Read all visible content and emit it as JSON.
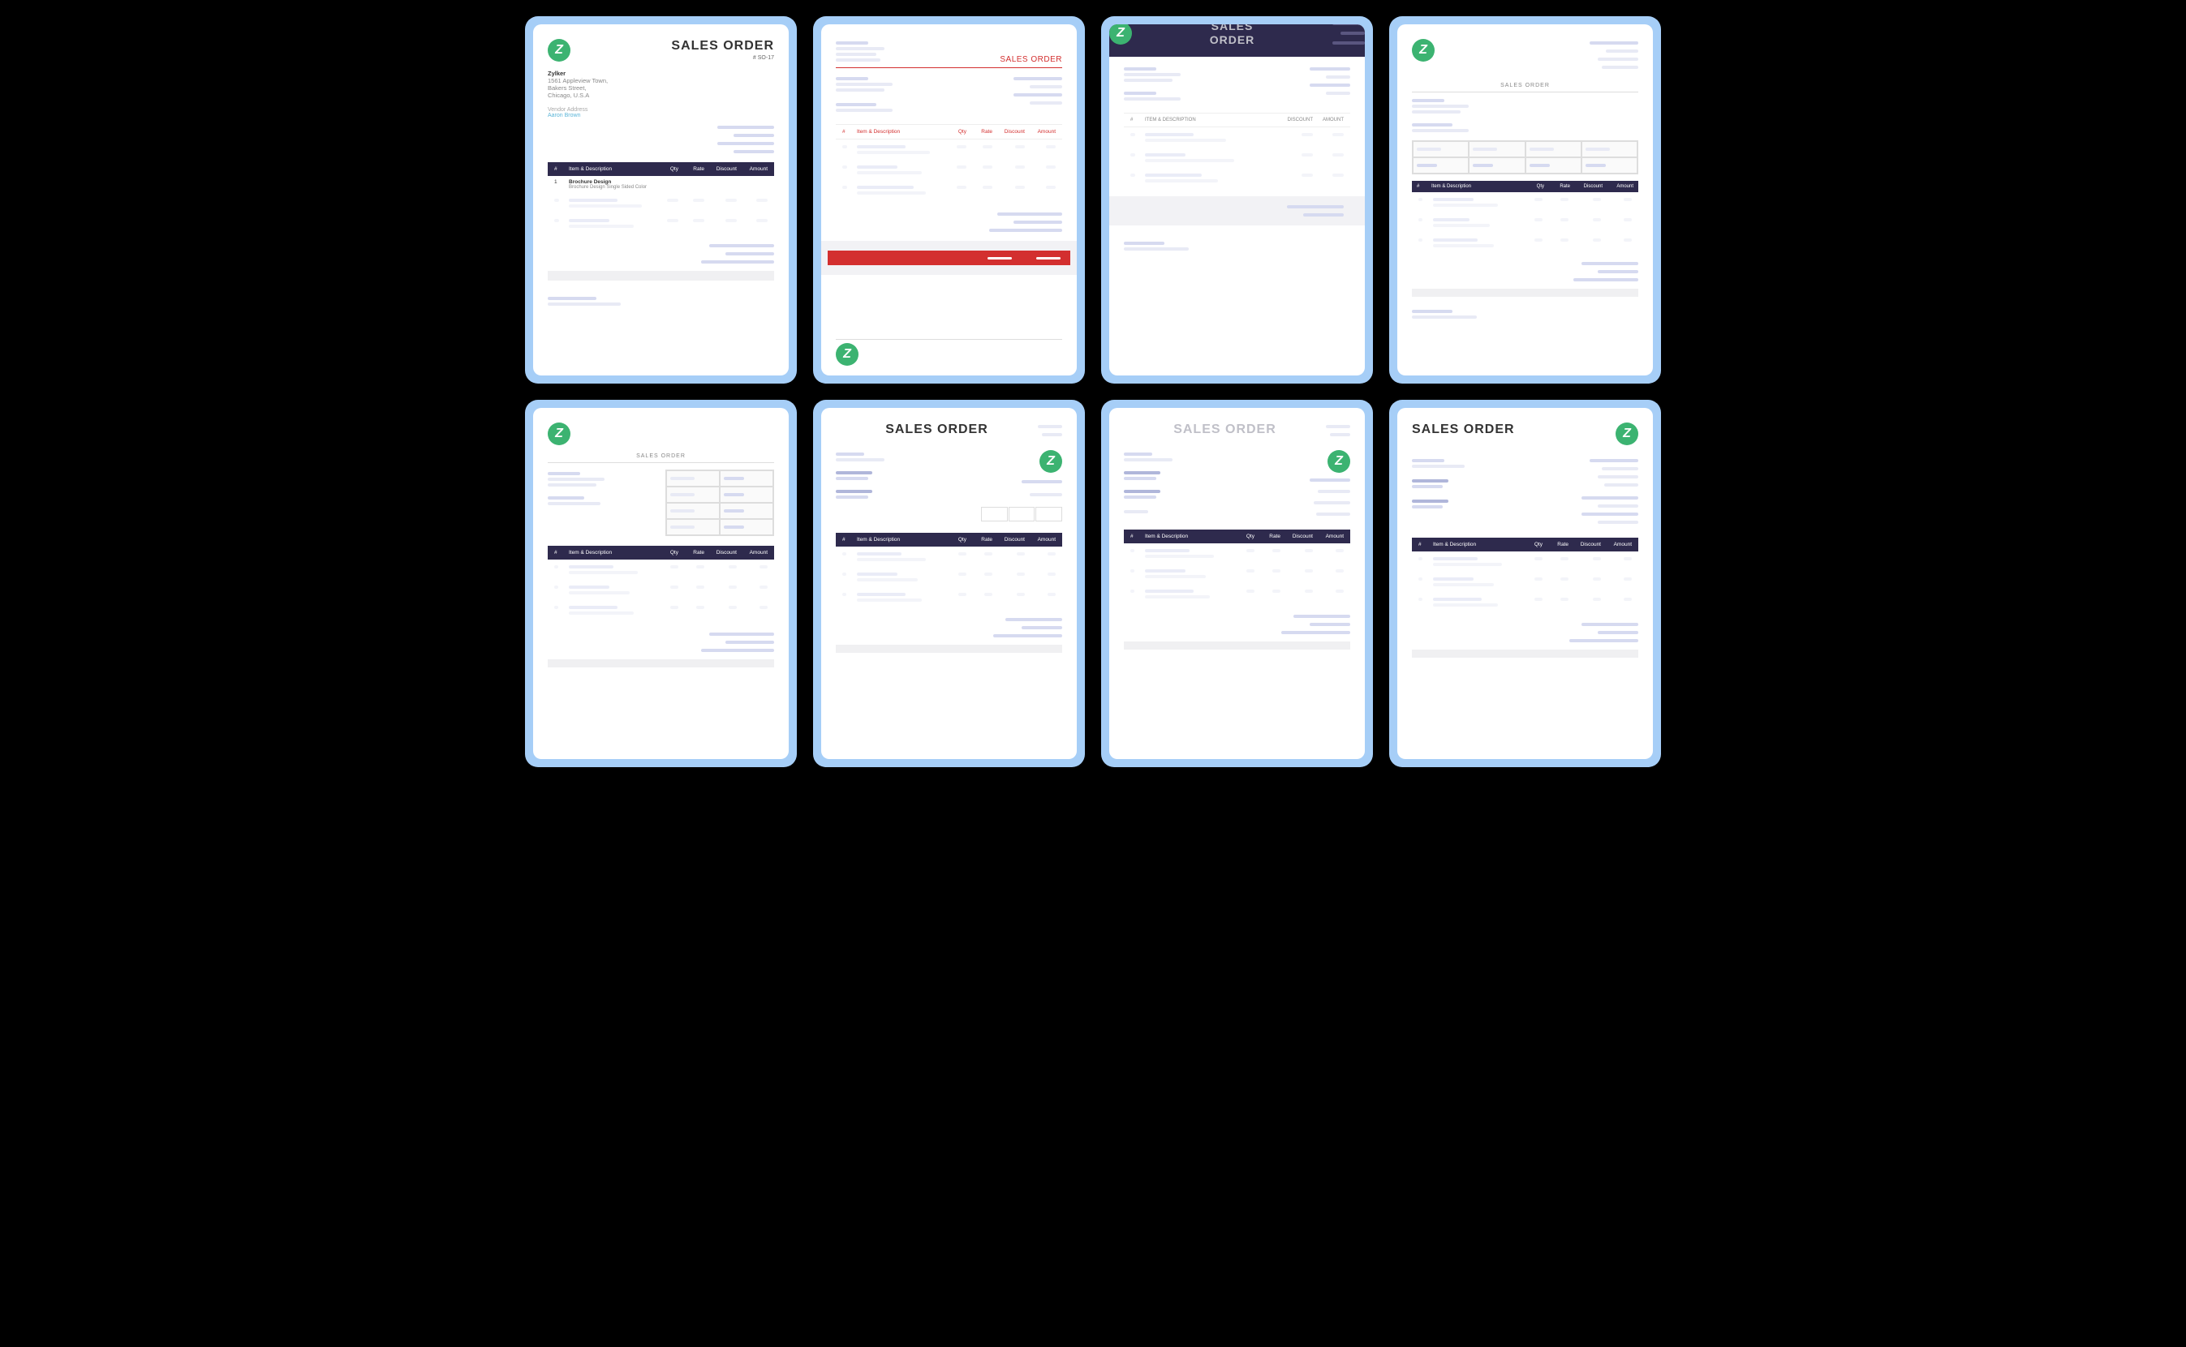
{
  "common": {
    "title": "SALES ORDER",
    "company": "Zylker",
    "address1": "1561 Appleview Town,",
    "address2": "Bakers Street,",
    "address3": "Chicago, U.S.A",
    "vendor_label": "Vendor Address",
    "vendor_name": "Aaron Brown",
    "order_number": "# SO-17",
    "logo_letter": "Z",
    "headers": {
      "num": "#",
      "desc": "Item & Description",
      "desc_caps": "ITEM & DESCRIPTION",
      "qty": "Qty",
      "rate": "Rate",
      "discount": "Discount",
      "discount_caps": "DISCOUNT",
      "amount": "Amount",
      "amount_caps": "AMOUNT"
    },
    "item1": {
      "num": "1",
      "name": "Brochure Design",
      "sub": "Brochure Design Single Sided Color"
    }
  }
}
